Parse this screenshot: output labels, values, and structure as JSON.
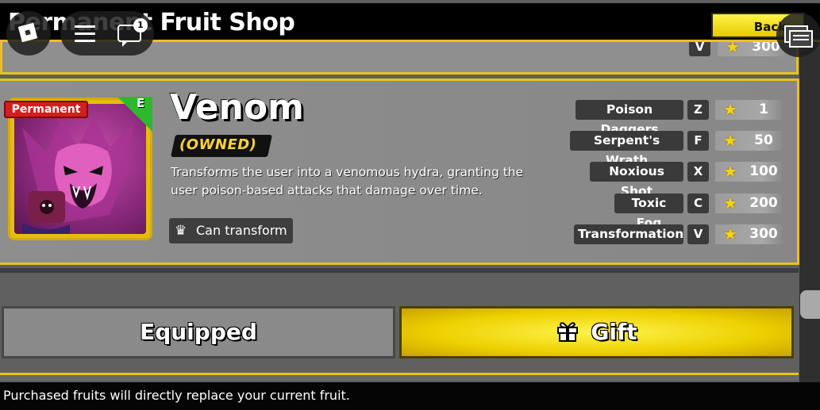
{
  "shop": {
    "title": "Permanent Fruit Shop",
    "back_label": "Back"
  },
  "roblox": {
    "chat_badge_count": "1"
  },
  "prev_card": {
    "key": "V",
    "cost": "300"
  },
  "fruit": {
    "badge": "Permanent",
    "rarity": "E",
    "name": "Venom",
    "status": "(OWNED)",
    "description": "Transforms the user into a venomous hydra, granting the user poison-based attacks that damage over time.",
    "ability_tag": "Can transform",
    "moves": [
      {
        "name": "Poison Daggers",
        "key": "Z",
        "cost": "1"
      },
      {
        "name": "Serpent's Wrath",
        "key": "F",
        "cost": "50"
      },
      {
        "name": "Noxious Shot",
        "key": "X",
        "cost": "100"
      },
      {
        "name": "Toxic Fog",
        "key": "C",
        "cost": "200"
      },
      {
        "name": "Transformation",
        "key": "V",
        "cost": "300"
      }
    ]
  },
  "buttons": {
    "equipped": "Equipped",
    "gift": "Gift"
  },
  "footer": {
    "notice": "Purchased fruits will directly replace your current fruit."
  },
  "colors": {
    "accent_gold": "#e9c21c",
    "gift_yellow": "#ecd000",
    "badge_red": "#d31e1e",
    "rarity_green": "#2eb82e",
    "star": "#f4d21a"
  }
}
